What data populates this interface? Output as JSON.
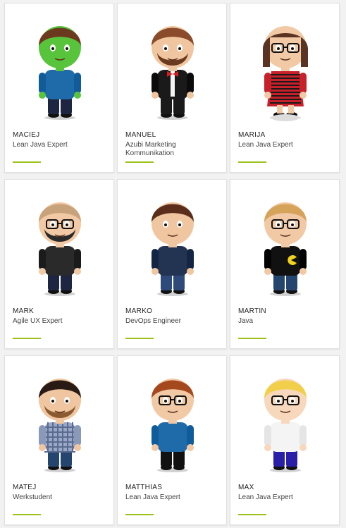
{
  "accent_color": "#9cc21a",
  "team": [
    {
      "name": "MACIEJ",
      "role": "Lean Java Expert",
      "avatar": {
        "hair": "#6b3a1e",
        "skin": "#58c43c",
        "shirt": "#1f6aa8",
        "pants": "#1d2540",
        "glasses": false,
        "beard": false
      }
    },
    {
      "name": "MANUEL",
      "role": "Azubi Marketing Kommunikation",
      "avatar": {
        "hair": "#8a4b2a",
        "skin": "#f0c6a0",
        "shirt": "#1a1a1a",
        "pants": "#1a1a1a",
        "glasses": false,
        "beard": true,
        "beard_color": "#6b3a1e",
        "bowtie": true
      }
    },
    {
      "name": "MARIJA",
      "role": "Lean Java Expert",
      "avatar": {
        "hair": "#5a3322",
        "skin": "#f2c9a5",
        "shirt": "#c8202a",
        "pants": "#c8202a",
        "glasses": true,
        "beard": false,
        "stripes": true,
        "dress": true
      }
    },
    {
      "name": "MARK",
      "role": "Agile UX Expert",
      "avatar": {
        "hair": "#c8a27a",
        "skin": "#f2c9a5",
        "shirt": "#2a2a2a",
        "pants": "#1d2540",
        "glasses": true,
        "beard": true,
        "beard_color": "#2a2a2a"
      }
    },
    {
      "name": "MARKO",
      "role": "DevOps Engineer",
      "avatar": {
        "hair": "#5a2e1a",
        "skin": "#f0c6a0",
        "shirt": "#233352",
        "pants": "#2d4a7a",
        "glasses": false,
        "beard": false
      }
    },
    {
      "name": "MARTIN",
      "role": "Java",
      "avatar": {
        "hair": "#d6a35a",
        "skin": "#f2c9a5",
        "shirt": "#111111",
        "pants": "#24456e",
        "glasses": true,
        "beard": false,
        "pacman": true
      }
    },
    {
      "name": "MATEJ",
      "role": "Werkstudent",
      "avatar": {
        "hair": "#2a1a14",
        "skin": "#f0c6a0",
        "shirt": "#9aa8c8",
        "pants": "#24456e",
        "glasses": false,
        "beard": true,
        "beard_color": "#8a5a30",
        "plaid": true
      }
    },
    {
      "name": "MATTHIAS",
      "role": "Lean Java Expert",
      "avatar": {
        "hair": "#a4481e",
        "skin": "#f2c9a5",
        "shirt": "#1f6aa8",
        "pants": "#111111",
        "glasses": true,
        "beard": false
      }
    },
    {
      "name": "MAX",
      "role": "Lean Java Expert",
      "avatar": {
        "hair": "#f2cf4a",
        "skin": "#f7d8bd",
        "shirt": "#f4f4f4",
        "pants": "#2a1fa8",
        "glasses": true,
        "beard": false
      }
    }
  ]
}
